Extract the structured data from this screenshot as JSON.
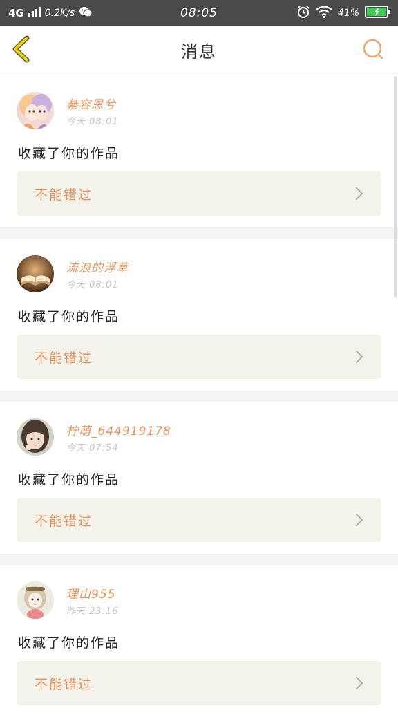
{
  "status_bar": {
    "network": "4G",
    "speed": "0.2K/s",
    "time": "08:05",
    "battery": "41%"
  },
  "header": {
    "title": "消息"
  },
  "colors": {
    "accent": "#e8925a",
    "status_bar_bg": "#4a4a4a",
    "back_icon": "#e8c400",
    "action_bg": "#f3f3ec"
  },
  "messages": [
    {
      "user": "綦容恩兮",
      "time": "今天 08:01",
      "text": "收藏了你的作品",
      "action": "不能错过",
      "avatar_icon": "anime-avatar"
    },
    {
      "user": "流浪的浮草",
      "time": "今天 08:01",
      "text": "收藏了你的作品",
      "action": "不能错过",
      "avatar_icon": "book-avatar"
    },
    {
      "user": "柠萌_644919178",
      "time": "今天 07:54",
      "text": "收藏了你的作品",
      "action": "不能错过",
      "avatar_icon": "girl-avatar"
    },
    {
      "user": "理山955",
      "time": "昨天 23:16",
      "text": "收藏了你的作品",
      "action": "不能错过",
      "avatar_icon": "doll-avatar"
    }
  ]
}
